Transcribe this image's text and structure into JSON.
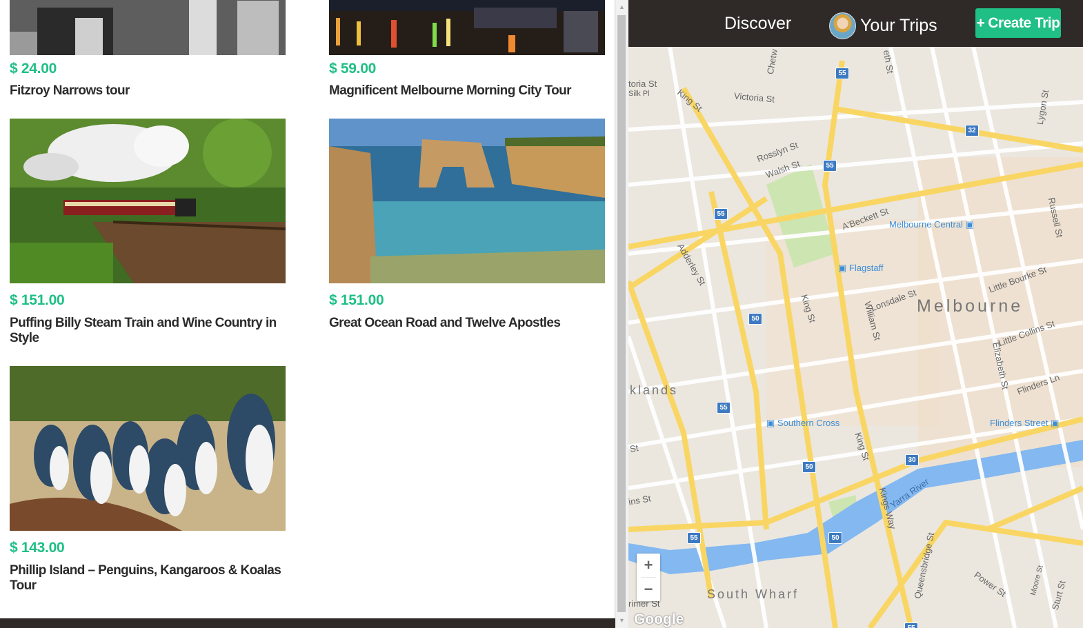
{
  "tours": [
    {
      "price": "$ 24.00",
      "title": "Fitzroy Narrows tour",
      "image": "campfire-photo"
    },
    {
      "price": "$ 59.00",
      "title": "Magnificent Melbourne Morning City Tour",
      "image": "city-night-photo"
    },
    {
      "price": "$ 151.00",
      "title": "Puffing Billy Steam Train and Wine Country in Style",
      "image": "steam-train-photo"
    },
    {
      "price": "$ 151.00",
      "title": "Great Ocean Road and Twelve Apostles",
      "image": "coast-photo"
    },
    {
      "price": "$ 143.00",
      "title": "Phillip Island – Penguins, Kangaroos & Koalas Tour",
      "image": "penguins-photo"
    }
  ],
  "nav": {
    "discover": "Discover",
    "your_trips": "Your Trips",
    "create_trip": "Create Trip",
    "create_icon": "+"
  },
  "map": {
    "zoom_in": "+",
    "zoom_out": "−",
    "attribution": "Google",
    "labels": {
      "city": "Melbourne",
      "docklands": "klands",
      "south_wharf": "South Wharf",
      "yarra": "Yarra River",
      "victoria_st": "Victoria St",
      "toria_st": "toria St",
      "silk_pl": "Silk Pl",
      "king_st_top": "King St",
      "king_st_mid": "King St",
      "king_st_low": "King St",
      "kings_way": "Kings Way",
      "william_st": "William St",
      "lonsdale_st": "Lonsdale St",
      "little_bourke": "Little Bourke St",
      "little_collins": "Little Collins St",
      "flinders_ln": "Flinders Ln",
      "elizabeth_st": "Elizabeth St",
      "russell_st": "Russell St",
      "lygon_st": "Lygon St",
      "abeckett_st": "A'Beckett St",
      "rosslyn_st": "Rosslyn St",
      "walsh_st": "Walsh St",
      "adderley_st": "Adderley St",
      "queensbridge_st": "Queensbridge St",
      "power_st": "Power St",
      "moore_st": "Moore St",
      "sturt_st": "Sturt St",
      "chetw": "Chetw",
      "eth_st": "eth St",
      "primer_st": "rimer St",
      "ins_st": "ins St",
      "st": "St"
    },
    "stations": {
      "melbourne_central": "Melbourne Central",
      "flagstaff": "Flagstaff",
      "southern_cross": "Southern Cross",
      "flinders_street": "Flinders Street"
    },
    "route_shields": [
      "55",
      "55",
      "55",
      "55",
      "55",
      "55",
      "50",
      "50",
      "50",
      "30",
      "32"
    ]
  }
}
